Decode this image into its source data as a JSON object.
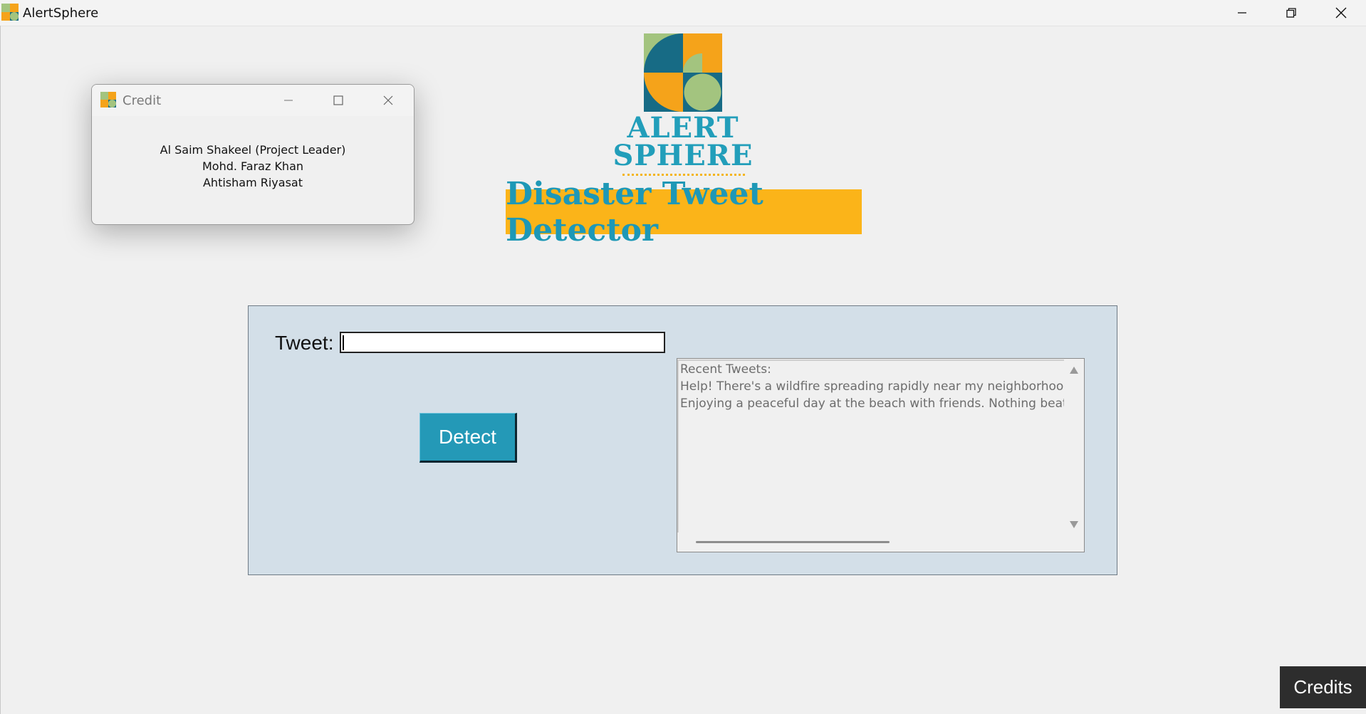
{
  "window": {
    "title": "AlertSphere",
    "icon": "alertsphere-logo-icon",
    "controls": [
      "minimize-icon",
      "restore-icon",
      "close-icon"
    ]
  },
  "logo": {
    "line1": "ALERT",
    "line2": "SPHERE",
    "colors": {
      "green": "#a3c47f",
      "orange": "#f5a31a",
      "teal": "#176b85"
    }
  },
  "banner": {
    "text": "Disaster Tweet Detector",
    "background": "#fbb419",
    "text_color": "#1e98b6"
  },
  "form": {
    "tweet_label": "Tweet:",
    "tweet_value": "",
    "detect_label": "Detect",
    "accent": "#2499b7"
  },
  "recent": {
    "header": "Recent Tweets:",
    "items": [
      "Help! There's a wildfire spreading rapidly near my neighborhood. Fla",
      "Enjoying a peaceful day at the beach with friends. Nothing beats the"
    ]
  },
  "credits_button": {
    "label": "Credits"
  },
  "credit_dialog": {
    "title": "Credit",
    "lines": [
      "Al Saim Shakeel (Project Leader)",
      "Mohd. Faraz Khan",
      "Ahtisham Riyasat"
    ]
  }
}
